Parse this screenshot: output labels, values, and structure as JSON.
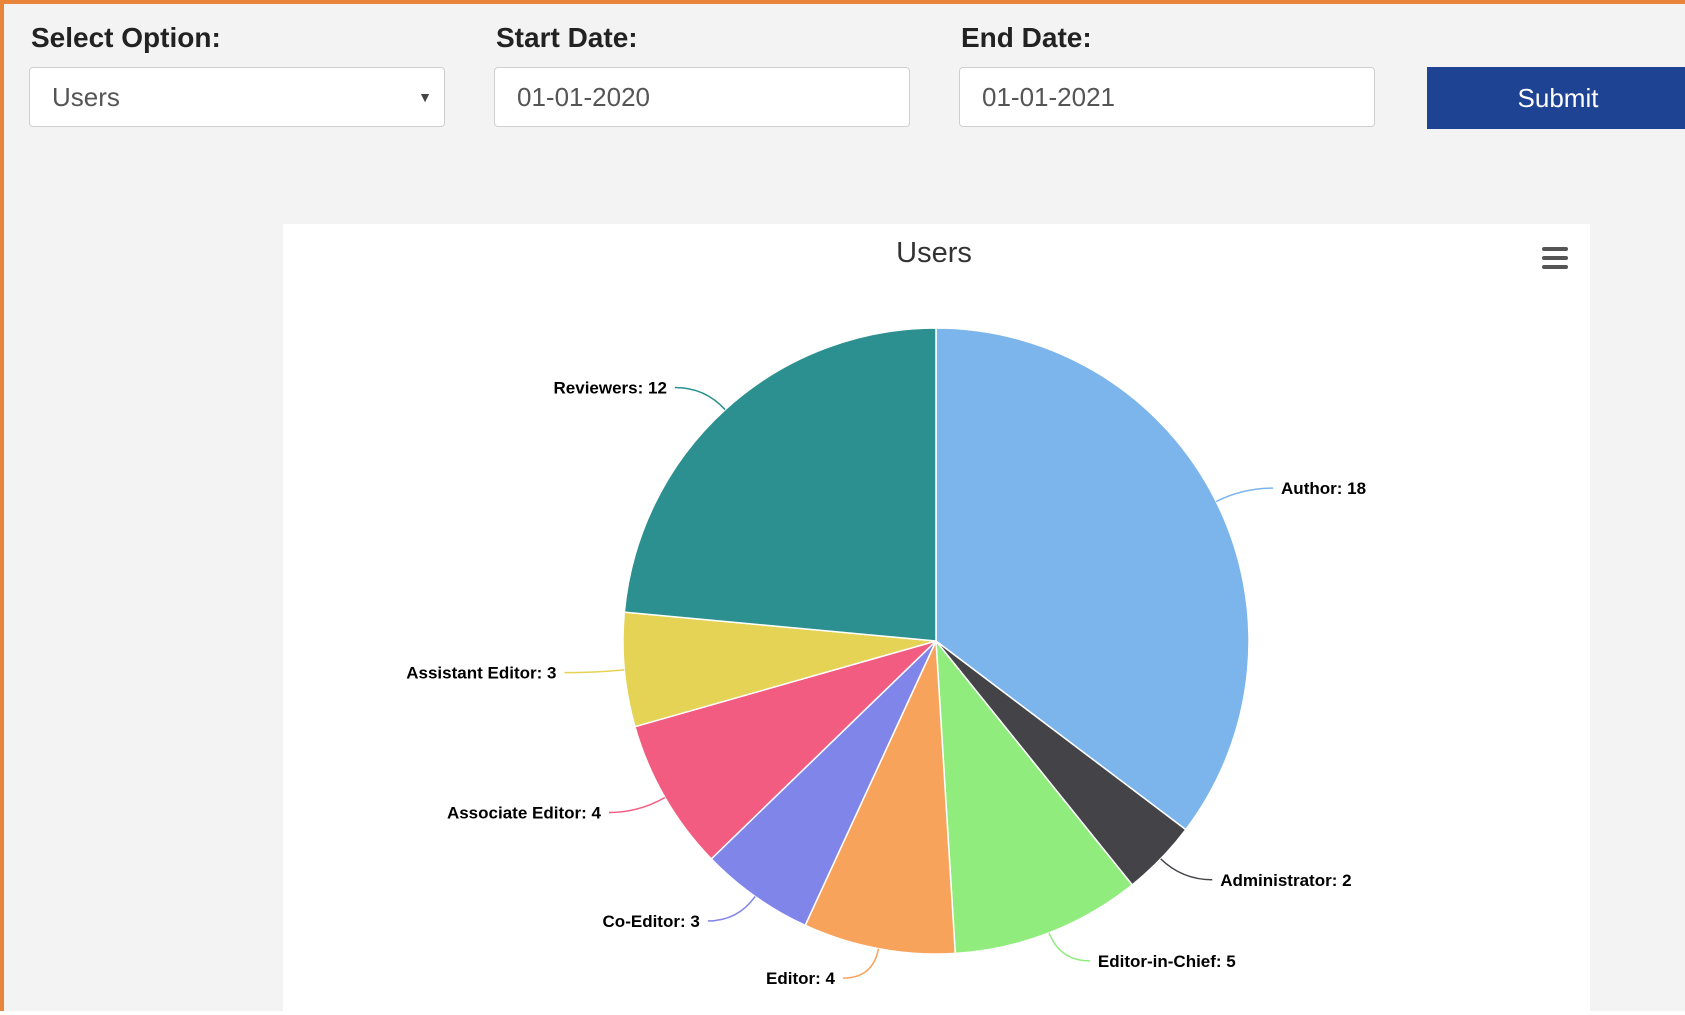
{
  "form": {
    "select_label": "Select Option:",
    "select_value": "Users",
    "start_label": "Start Date:",
    "start_value": "01-01-2020",
    "end_label": "End Date:",
    "end_value": "01-01-2021",
    "submit_label": "Submit"
  },
  "colors": {
    "accent_border": "#e8853a",
    "submit_bg": "#1f4393"
  },
  "chart_data": {
    "type": "pie",
    "title": "Users",
    "slices": [
      {
        "name": "Author",
        "value": 18,
        "color": "#7cb5ec"
      },
      {
        "name": "Administrator",
        "value": 2,
        "color": "#434348"
      },
      {
        "name": "Editor-in-Chief",
        "value": 5,
        "color": "#90ed7d"
      },
      {
        "name": "Editor",
        "value": 4,
        "color": "#f7a35c"
      },
      {
        "name": "Co-Editor",
        "value": 3,
        "color": "#8085e9"
      },
      {
        "name": "Associate Editor",
        "value": 4,
        "color": "#f15c80"
      },
      {
        "name": "Assistant Editor",
        "value": 3,
        "color": "#e4d354"
      },
      {
        "name": "Reviewers",
        "value": 12,
        "color": "#2b908f"
      }
    ]
  }
}
